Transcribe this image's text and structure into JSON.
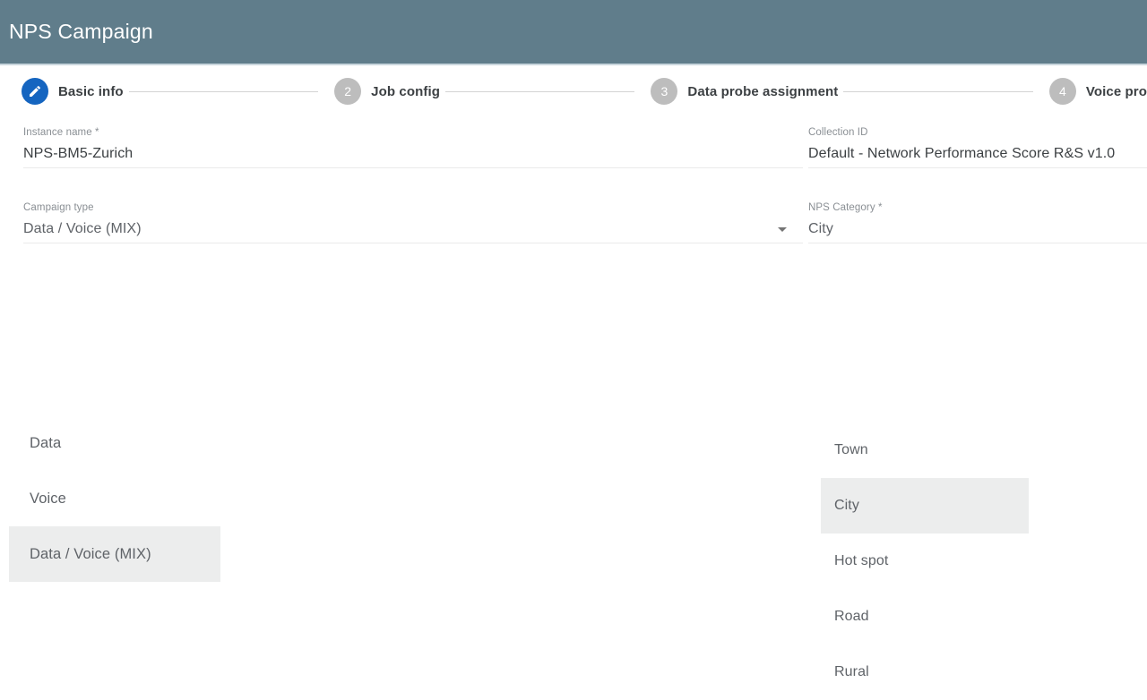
{
  "appbar": {
    "title": "NPS Campaign"
  },
  "stepper": {
    "steps": [
      {
        "index": "1",
        "label": "Basic info",
        "state": "active",
        "icon": "pencil-icon"
      },
      {
        "index": "2",
        "label": "Job config",
        "state": "inactive"
      },
      {
        "index": "3",
        "label": "Data probe assignment",
        "state": "inactive"
      },
      {
        "index": "4",
        "label": "Voice pro",
        "state": "inactive"
      }
    ]
  },
  "form": {
    "instance_name": {
      "label": "Instance name *",
      "value": "NPS-BM5-Zurich"
    },
    "collection_id": {
      "label": "Collection ID",
      "value": "Default - Network Performance Score R&S v1.0"
    },
    "campaign_type": {
      "label": "Campaign type",
      "value": "Data / Voice (MIX)",
      "caret_icon": "chevron-down-icon",
      "options": [
        {
          "label": "Data",
          "selected": false
        },
        {
          "label": "Voice",
          "selected": false
        },
        {
          "label": "Data / Voice (MIX)",
          "selected": true
        }
      ]
    },
    "nps_category": {
      "label": "NPS Category *",
      "value": "City",
      "options": [
        {
          "label": "Town",
          "selected": false
        },
        {
          "label": "City",
          "selected": true
        },
        {
          "label": "Hot spot",
          "selected": false
        },
        {
          "label": "Road",
          "selected": false
        },
        {
          "label": "Rural",
          "selected": false
        }
      ]
    }
  },
  "colors": {
    "appbar": "#607d8b",
    "active_step": "#1565c0",
    "inactive_step": "#bdbdbd",
    "selected_option": "#eceded"
  }
}
